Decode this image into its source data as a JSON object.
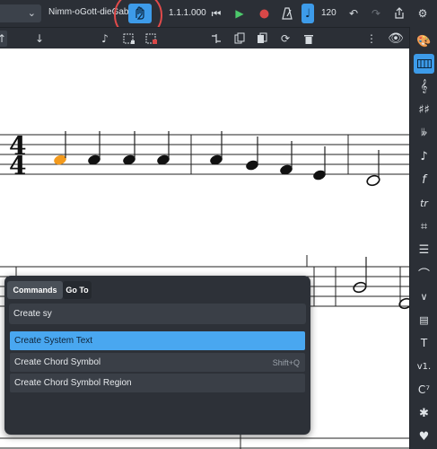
{
  "toolbar": {
    "score_title": "Nimm-oGott-dieGabe...",
    "position": "1.1.1.000",
    "tempo": "120"
  },
  "command_palette": {
    "tabs": [
      "Commands",
      "Go To"
    ],
    "query": "Create sy",
    "results": [
      {
        "label": "Create System Text",
        "shortcut": "",
        "selected": true
      },
      {
        "label": "Create Chord Symbol",
        "shortcut": "Shift+Q",
        "selected": false
      },
      {
        "label": "Create Chord Symbol Region",
        "shortcut": "",
        "selected": false
      }
    ]
  },
  "score": {
    "time_signature_top": "4",
    "time_signature_bottom": "4"
  },
  "palette": {
    "items": [
      "palette-icon",
      "keyboard-icon",
      "treble-clef-icon",
      "key-signature-icon",
      "time-signature-icon",
      "tuplet-icon",
      "dynamics-icon",
      "hairpin-icon",
      "repeat-icon",
      "barline-icon",
      "fermata-icon",
      "ornament-icon",
      "lyrics-icon",
      "text-icon",
      "voltas-icon",
      "chord-icon",
      "tools-icon",
      "heart-icon"
    ]
  },
  "colors": {
    "toolbar_bg": "#2b2f36",
    "accent": "#3d9be9",
    "selected_note": "#f39a1c",
    "highlight_circle": "#e14a4a"
  }
}
